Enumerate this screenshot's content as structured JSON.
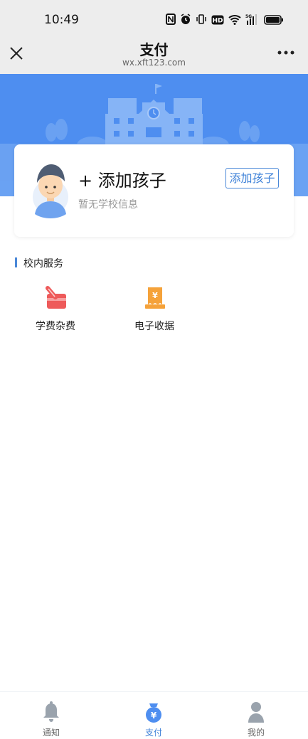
{
  "status": {
    "time": "10:49",
    "network": "5G"
  },
  "nav": {
    "title": "支付",
    "url": "wx.xft123.com"
  },
  "child_card": {
    "title": "+ 添加孩子",
    "subtitle": "暂无学校信息",
    "add_button": "添加孩子"
  },
  "services": {
    "title": "校内服务",
    "items": [
      {
        "label": "学费杂费",
        "icon": "tuition-card-icon",
        "color": "#ee5a5a"
      },
      {
        "label": "电子收据",
        "icon": "receipt-icon",
        "color": "#f5a23a"
      }
    ]
  },
  "tabs": [
    {
      "label": "通知",
      "icon": "bell-icon",
      "active": false
    },
    {
      "label": "支付",
      "icon": "money-bag-icon",
      "active": true
    },
    {
      "label": "我的",
      "icon": "person-icon",
      "active": false
    }
  ],
  "colors": {
    "accent": "#4e8ef0",
    "banner": "#4e8ef0"
  }
}
